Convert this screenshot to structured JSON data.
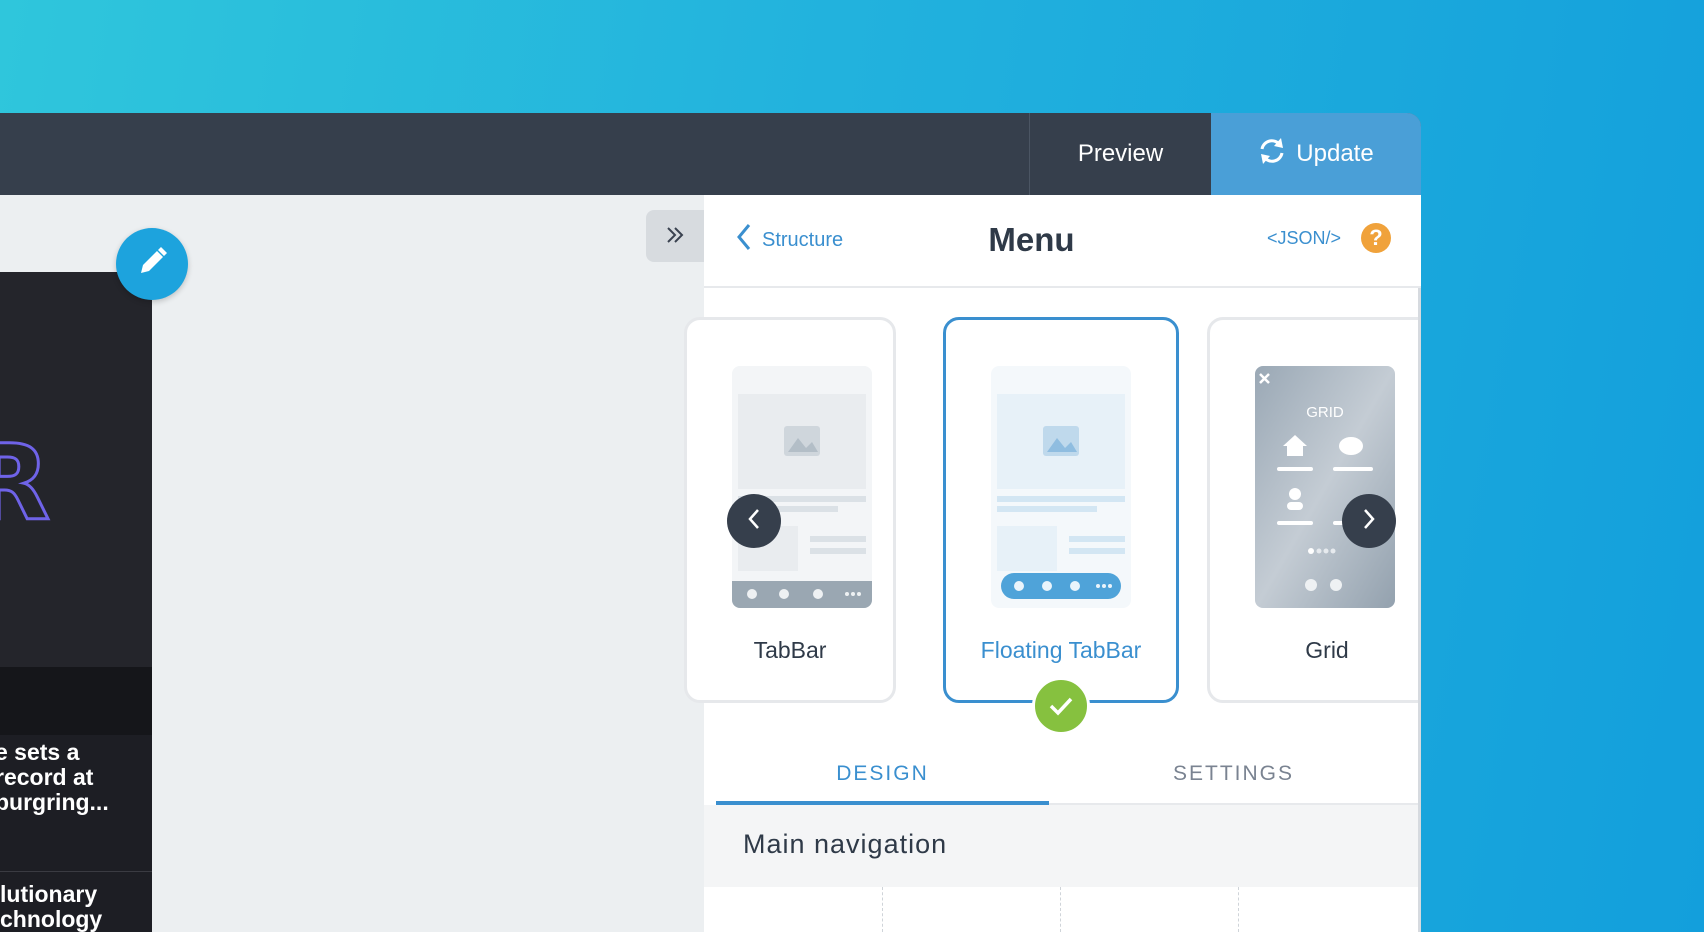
{
  "topbar": {
    "preview_label": "Preview",
    "update_label": "Update"
  },
  "preview_phone": {
    "article_1_lines": [
      "e sets a",
      "record at",
      "burgring..."
    ],
    "article_2_lines": [
      "lutionary",
      "chnology"
    ]
  },
  "panel": {
    "back_label": "Structure",
    "title": "Menu",
    "json_label": "<JSON/>",
    "help_label": "?"
  },
  "menu_styles": [
    {
      "label": "TabBar",
      "selected": false
    },
    {
      "label": "Floating TabBar",
      "selected": true
    },
    {
      "label": "Grid",
      "selected": false
    }
  ],
  "grid_mock_title": "GRID",
  "tabs": {
    "design": "DESIGN",
    "settings": "SETTINGS"
  },
  "section": {
    "title": "Main navigation"
  },
  "colors": {
    "accent": "#3a8fcf",
    "topbar": "#363f4c",
    "update": "#4a9fd7",
    "success": "#86c13f",
    "help": "#f0a23b"
  }
}
